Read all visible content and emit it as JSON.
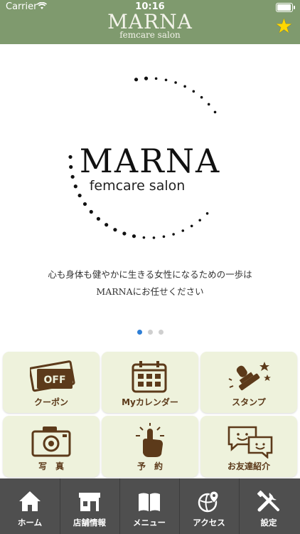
{
  "status": {
    "carrier": "Carrier",
    "time": "10:16"
  },
  "header": {
    "logo": "MARNA",
    "subtitle": "femcare salon"
  },
  "hero": {
    "logo": "MARNA",
    "subtitle": "femcare salon",
    "tagline_line1": "心も身体も健やかに生きる女性になるための一歩は",
    "tagline_line2": "MARNAにお任せください"
  },
  "carousel": {
    "total": 3,
    "active": 1
  },
  "menu": {
    "items": [
      {
        "label": "クーポン",
        "icon": "coupon-off-icon"
      },
      {
        "label": "Myカレンダー",
        "icon": "calendar-icon"
      },
      {
        "label": "スタンプ",
        "icon": "stamp-icon"
      },
      {
        "label": "写　真",
        "icon": "camera-icon"
      },
      {
        "label": "予　約",
        "icon": "tap-finger-icon"
      },
      {
        "label": "お友達紹介",
        "icon": "chat-bubbles-icon"
      }
    ]
  },
  "tabbar": {
    "items": [
      {
        "label": "ホーム",
        "icon": "home-icon"
      },
      {
        "label": "店舗情報",
        "icon": "shop-icon"
      },
      {
        "label": "メニュー",
        "icon": "book-icon"
      },
      {
        "label": "アクセス",
        "icon": "map-pin-icon"
      },
      {
        "label": "設定",
        "icon": "tools-icon"
      }
    ]
  },
  "colors": {
    "header": "#7f9a6e",
    "tile": "#eef2dc",
    "tile_text": "#5c3a1a",
    "tabbar": "#4f4f4f",
    "dot_active": "#2f7fd6"
  }
}
